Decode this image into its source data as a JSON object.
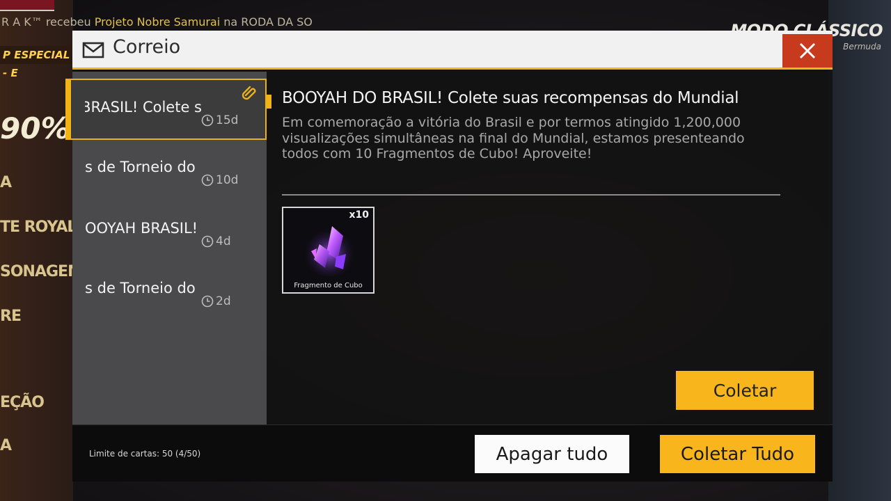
{
  "background": {
    "ticker_prefix": "R A K™ recebeu ",
    "ticker_highlight": "Projeto Nobre Samurai",
    "ticker_suffix": " na RODA DA SO",
    "promo": "P ESPECIAL - E",
    "percent": "90%",
    "mode_title": "MODO CLÁSSICO",
    "mode_sub": "Bermuda",
    "menu": [
      "A",
      "TE ROYALE",
      "SONAGEM",
      "RE",
      "EÇÃO",
      "A"
    ]
  },
  "modal": {
    "title": "Correio",
    "mail_icon": "envelope-icon",
    "close_icon": "close-icon"
  },
  "mail_list": [
    {
      "subject": "BOOYAH DO BRASIL! Colete s",
      "time": "15d",
      "selected": true,
      "has_attachment": true
    },
    {
      "subject": "Recompensas de Torneio do",
      "time": "10d",
      "selected": false,
      "has_attachment": false
    },
    {
      "subject": "BOOYAH BRASIL!",
      "time": "4d",
      "selected": false,
      "has_attachment": false
    },
    {
      "subject": "Recompensas de Torneio do",
      "time": "2d",
      "selected": false,
      "has_attachment": false
    }
  ],
  "mail_visible_subjects": [
    "BRASIL! Colete s",
    "s de Torneio do",
    "OOYAH BRASIL!",
    "s de Torneio do"
  ],
  "content": {
    "title": "BOOYAH DO BRASIL! Colete suas recompensas do Mundial",
    "body": "Em comemoração a vitória do Brasil e por termos atingido 1,200,000 visualizações simultâneas na final do Mundial, estamos presenteando todos com 10 Fragmentos de Cubo! Aproveite!",
    "reward": {
      "name": "Fragmento de Cubo",
      "quantity": "x10",
      "icon": "cube-fragment-icon"
    },
    "collect_label": "Coletar"
  },
  "footer": {
    "limit_text": "Limite de cartas: 50 (4/50)",
    "delete_all_label": "Apagar tudo",
    "collect_all_label": "Coletar Tudo"
  },
  "colors": {
    "accent": "#f8b51c",
    "close": "#c73a1e",
    "list_bg": "#4a4a4c"
  }
}
